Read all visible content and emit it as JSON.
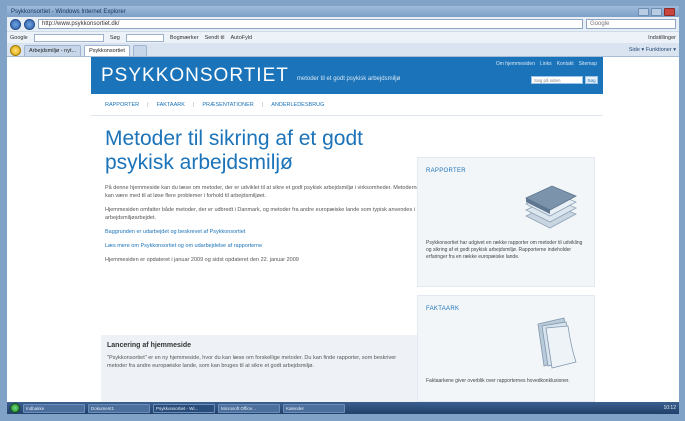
{
  "window": {
    "title": "Psykkonsortiet - Windows Internet Explorer"
  },
  "address": {
    "url": "http://www.psykkonsortiet.dk/",
    "search_placeholder": "Google"
  },
  "toolbar": {
    "google_label": "Google",
    "items": [
      "Søg",
      "Bogmærker",
      "Sendt til",
      "AutoFyld",
      "Indstillinger"
    ]
  },
  "tabs": [
    {
      "label": "Arbejdsmiljø - nyt..."
    },
    {
      "label": "Psykkonsortiet"
    }
  ],
  "tools_label": "Side ▾  Funktioner ▾",
  "site": {
    "logo": "PSYKKONSORTIET",
    "tagline": "metoder til et godt psykisk arbejdsmiljø",
    "util_links": [
      "Om hjemmesiden",
      "Links",
      "Kontakt",
      "Sitemap"
    ],
    "search_placeholder": "Søg på siden",
    "search_button": "Søg",
    "nav": [
      "RAPPORTER",
      "FAKTAARK",
      "PRÆSENTATIONER",
      "ANDERLEDESBRUG"
    ],
    "heading": "Metoder til sikring af et godt psykisk arbejdsmiljø",
    "paragraphs": [
      "På denne hjemmeside kan du læse om metoder, der er udviklet til at sikre et godt psykisk arbejdsmiljø i virksomheder. Metoderne kan være med til at løse flere problemer i forhold til arbejdsmiljøet.",
      "Hjemmesiden omfatter både metoder, der er udbredt i Danmark, og metoder fra andre europæiske lande som typisk anvendes i arbejdsmiljøarbejdet."
    ],
    "links": [
      "Baggrunden er udarbejdet og beskrevet af Psykkonsortiet",
      "Læs mere om Psykkonsortiet og om udarbejdelse af rapporterne"
    ],
    "updated": "Hjemmesiden er opdateret i januar 2009 og sidst opdateret den 22. januar 2009",
    "section_title": "Lancering af hjemmeside",
    "section_text": "\"Psykkonsortiet\" er en ny hjemmeside, hvor du kan læse om forskellige metoder. Du kan finde rapporter, som beskriver metoder fra andre europæiske lande, som kan bruges til at sikre et godt arbejdsmiljø.",
    "sidebar": [
      {
        "title": "RAPPORTER",
        "text": "Psykkonsortiet har udgivet en række rapporter om metoder til udvikling og sikring af et godt psykisk arbejdsmiljø. Rapporterne indeholder erfaringer fra en række europæiske lande."
      },
      {
        "title": "FAKTAARK",
        "text": "Faktaarkene giver overblik over rapporternes hovedkonklusioner."
      }
    ]
  },
  "taskbar": {
    "items": [
      "Indbakke",
      "Dokument1",
      "Psykkonsortiet - Wi...",
      "Microsoft Office...",
      "Kalender"
    ],
    "clock": "10:12"
  },
  "colors": {
    "brand": "#1b73b9",
    "desktop": "#7fa2c6"
  }
}
